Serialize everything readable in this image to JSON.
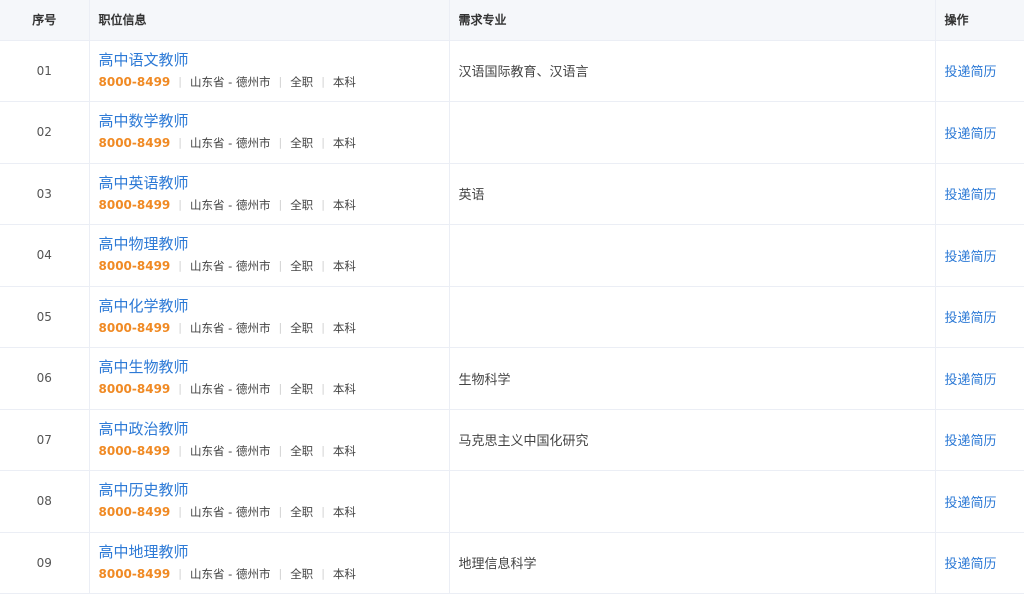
{
  "header": {
    "index": "序号",
    "position": "职位信息",
    "major": "需求专业",
    "action": "操作"
  },
  "separator": "|",
  "rows": [
    {
      "index": "01",
      "title": "高中语文教师",
      "salary": "8000-8499",
      "location": "山东省 - 德州市",
      "type": "全职",
      "education": "本科",
      "major": "汉语国际教育、汉语言",
      "action": "投递简历"
    },
    {
      "index": "02",
      "title": "高中数学教师",
      "salary": "8000-8499",
      "location": "山东省 - 德州市",
      "type": "全职",
      "education": "本科",
      "major": "",
      "action": "投递简历"
    },
    {
      "index": "03",
      "title": "高中英语教师",
      "salary": "8000-8499",
      "location": "山东省 - 德州市",
      "type": "全职",
      "education": "本科",
      "major": "英语",
      "action": "投递简历"
    },
    {
      "index": "04",
      "title": "高中物理教师",
      "salary": "8000-8499",
      "location": "山东省 - 德州市",
      "type": "全职",
      "education": "本科",
      "major": "",
      "action": "投递简历"
    },
    {
      "index": "05",
      "title": "高中化学教师",
      "salary": "8000-8499",
      "location": "山东省 - 德州市",
      "type": "全职",
      "education": "本科",
      "major": "",
      "action": "投递简历"
    },
    {
      "index": "06",
      "title": "高中生物教师",
      "salary": "8000-8499",
      "location": "山东省 - 德州市",
      "type": "全职",
      "education": "本科",
      "major": "生物科学",
      "action": "投递简历"
    },
    {
      "index": "07",
      "title": "高中政治教师",
      "salary": "8000-8499",
      "location": "山东省 - 德州市",
      "type": "全职",
      "education": "本科",
      "major": "马克思主义中国化研究",
      "action": "投递简历"
    },
    {
      "index": "08",
      "title": "高中历史教师",
      "salary": "8000-8499",
      "location": "山东省 - 德州市",
      "type": "全职",
      "education": "本科",
      "major": "",
      "action": "投递简历"
    },
    {
      "index": "09",
      "title": "高中地理教师",
      "salary": "8000-8499",
      "location": "山东省 - 德州市",
      "type": "全职",
      "education": "本科",
      "major": "地理信息科学",
      "action": "投递简历"
    }
  ],
  "colors": {
    "link": "#2d7ad6",
    "salary": "#f08a24",
    "header_bg": "#f5f7fa",
    "border": "#ebeef5"
  }
}
